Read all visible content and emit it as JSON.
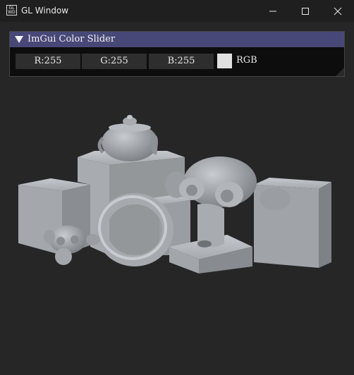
{
  "window": {
    "title": "GL Window",
    "icon_text": "GL\nWD",
    "controls": [
      "minimize-icon",
      "maximize-icon",
      "close-icon"
    ]
  },
  "imgui": {
    "title": "ImGui Color Slider",
    "sliders": [
      {
        "label": "R:255",
        "value": 255
      },
      {
        "label": "G:255",
        "value": 255
      },
      {
        "label": "B:255",
        "value": 255
      }
    ],
    "swatch_color": "#ffffff",
    "mode_label": "RGB"
  },
  "colors": {
    "background": "#262626",
    "titlebar": "#1f1f1f",
    "imgui_header": "#484878",
    "object_color": "#a0a4a8"
  }
}
